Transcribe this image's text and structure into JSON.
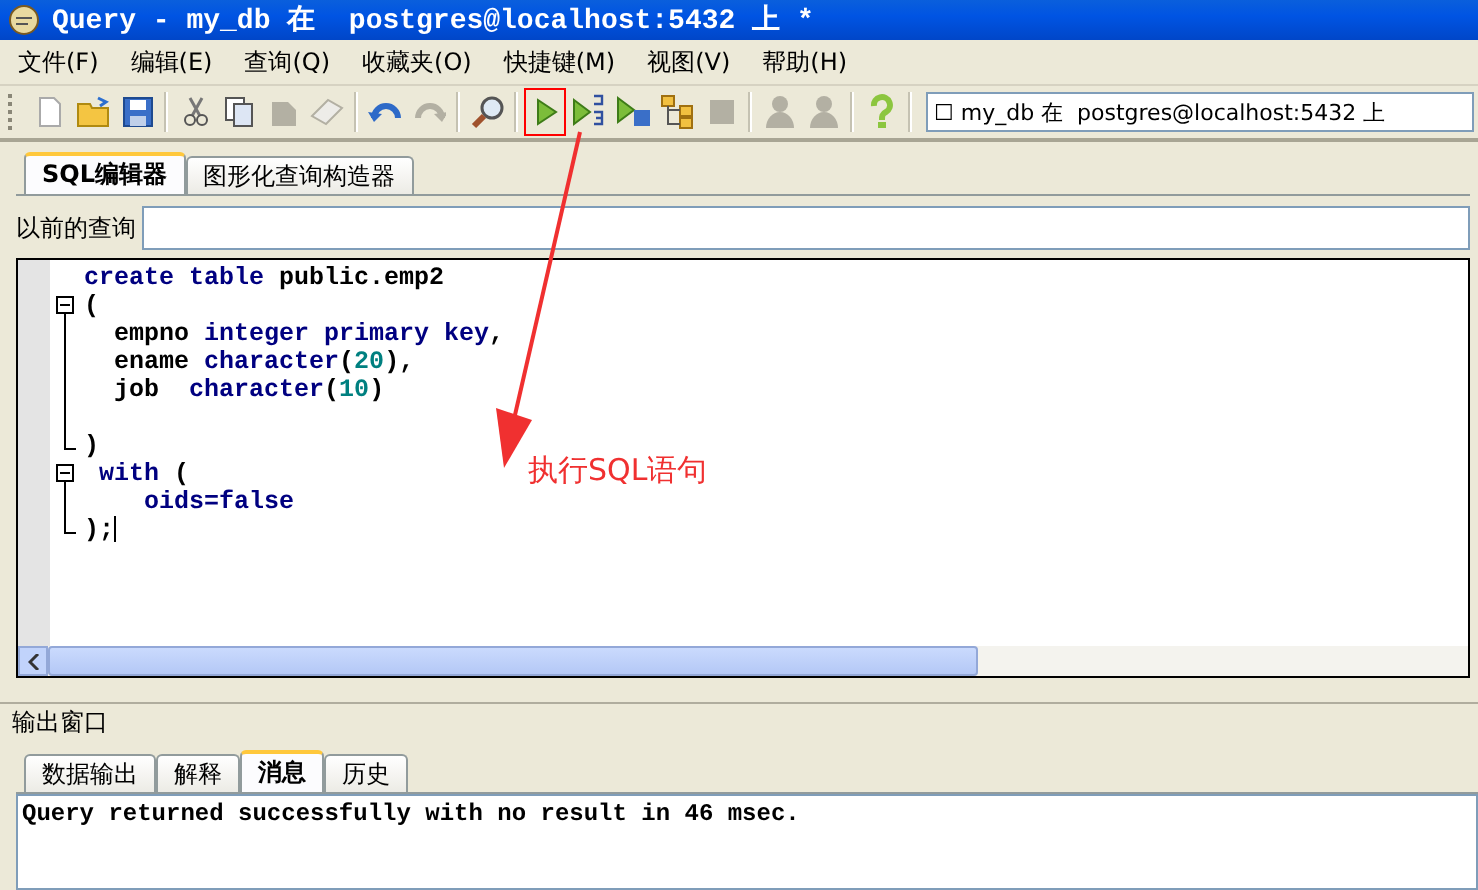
{
  "window": {
    "title": "Query - my_db 在  postgres@localhost:5432 上 *"
  },
  "menu": [
    "文件(F)",
    "编辑(E)",
    "查询(Q)",
    "收藏夹(O)",
    "快捷键(M)",
    "视图(V)",
    "帮助(H)"
  ],
  "toolbar": [
    {
      "kind": "new",
      "disabled": false,
      "highlighted": false
    },
    {
      "kind": "open",
      "disabled": false,
      "highlighted": false
    },
    {
      "kind": "save",
      "disabled": false,
      "highlighted": false
    },
    {
      "kind": "sep"
    },
    {
      "kind": "cut",
      "disabled": false,
      "highlighted": false
    },
    {
      "kind": "copy",
      "disabled": false,
      "highlighted": false
    },
    {
      "kind": "paste",
      "disabled": true,
      "highlighted": false
    },
    {
      "kind": "eraser",
      "disabled": true,
      "highlighted": false
    },
    {
      "kind": "sep"
    },
    {
      "kind": "undo",
      "disabled": false,
      "highlighted": false
    },
    {
      "kind": "redo",
      "disabled": true,
      "highlighted": false
    },
    {
      "kind": "sep"
    },
    {
      "kind": "find",
      "disabled": false,
      "highlighted": false
    },
    {
      "kind": "sep"
    },
    {
      "kind": "run",
      "disabled": false,
      "highlighted": true
    },
    {
      "kind": "run-pgscript",
      "disabled": false,
      "highlighted": false
    },
    {
      "kind": "run-save",
      "disabled": false,
      "highlighted": false
    },
    {
      "kind": "explain",
      "disabled": false,
      "highlighted": false
    },
    {
      "kind": "stop",
      "disabled": true,
      "highlighted": false
    },
    {
      "kind": "sep"
    },
    {
      "kind": "person",
      "disabled": true,
      "highlighted": false
    },
    {
      "kind": "person",
      "disabled": true,
      "highlighted": false
    },
    {
      "kind": "sep"
    },
    {
      "kind": "help",
      "disabled": false,
      "highlighted": false
    }
  ],
  "connection_combo": {
    "value": "☐ my_db 在  postgres@localhost:5432 上"
  },
  "editor_tabs": [
    {
      "label": "SQL编辑器",
      "selected": true
    },
    {
      "label": "图形化查询构造器",
      "selected": false
    }
  ],
  "previous_queries": {
    "label": "以前的查询"
  },
  "code": [
    {
      "kind": "plain",
      "tokens": [
        {
          "kind": "keyword",
          "text": "create table"
        },
        {
          "kind": "plain",
          "text": " public.emp2"
        }
      ]
    },
    {
      "kind": "fold-start",
      "tokens": [
        {
          "kind": "plain",
          "text": "("
        }
      ]
    },
    {
      "kind": "fold-body",
      "tokens": [
        {
          "kind": "plain",
          "text": "  empno "
        },
        {
          "kind": "keyword",
          "text": "integer primary key"
        },
        {
          "kind": "plain",
          "text": ","
        }
      ]
    },
    {
      "kind": "fold-body",
      "tokens": [
        {
          "kind": "plain",
          "text": "  ename "
        },
        {
          "kind": "keyword",
          "text": "character"
        },
        {
          "kind": "plain",
          "text": "("
        },
        {
          "kind": "number",
          "text": "20"
        },
        {
          "kind": "plain",
          "text": "),"
        }
      ]
    },
    {
      "kind": "fold-body",
      "tokens": [
        {
          "kind": "plain",
          "text": "  job  "
        },
        {
          "kind": "keyword",
          "text": "character"
        },
        {
          "kind": "plain",
          "text": "("
        },
        {
          "kind": "number",
          "text": "10"
        },
        {
          "kind": "plain",
          "text": ")"
        }
      ]
    },
    {
      "kind": "fold-body"
    },
    {
      "kind": "fold-end",
      "tokens": [
        {
          "kind": "plain",
          "text": ")"
        }
      ]
    },
    {
      "kind": "fold-start",
      "tokens": [
        {
          "kind": "keyword",
          "text": " with"
        },
        {
          "kind": "plain",
          "text": " ("
        }
      ]
    },
    {
      "kind": "fold-body",
      "tokens": [
        {
          "kind": "keyword",
          "text": "    oids=false"
        }
      ]
    },
    {
      "kind": "fold-end",
      "tokens": [
        {
          "kind": "plain",
          "text": ");"
        }
      ],
      "cursor": true
    }
  ],
  "output": {
    "title": "输出窗口",
    "tabs": [
      {
        "label": "数据输出",
        "selected": false
      },
      {
        "label": "解释",
        "selected": false
      },
      {
        "label": "消息",
        "selected": true
      },
      {
        "label": "历史",
        "selected": false
      }
    ],
    "message": "Query returned successfully with no result in 46 msec."
  },
  "annotation": {
    "text": "执行SQL语句"
  }
}
